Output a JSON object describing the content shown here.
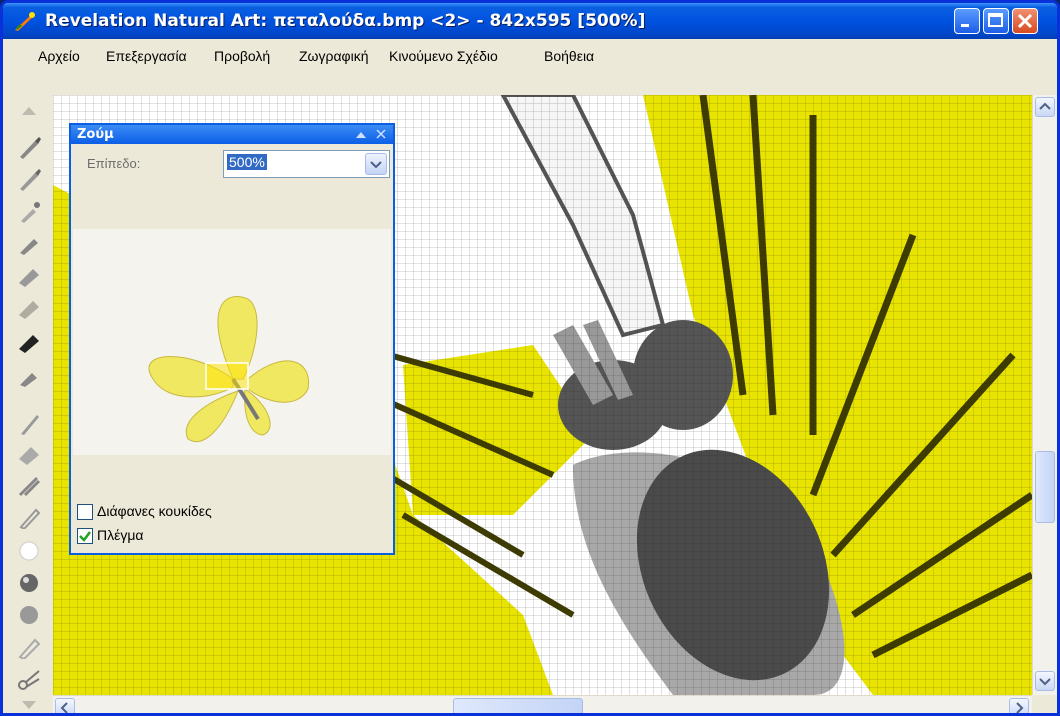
{
  "window": {
    "title": "Revelation Natural Art: πεταλούδα.bmp <2> - 842x595 [500%]",
    "colors": {
      "titlebar": "#0052e0",
      "canvas_yellow": "#e8e400",
      "grid": "#8a8600"
    }
  },
  "menu": [
    "Αρχείο",
    "Επεξεργασία",
    "Προβολή",
    "Ζωγραφική",
    "Κινούμενο Σχέδιο",
    "Βοήθεια"
  ],
  "zoom_panel": {
    "title": "Ζούμ",
    "level_label": "Επίπεδο:",
    "level_value": "500%",
    "transparent_dots_label": "Διάφανες κουκίδες",
    "transparent_dots_checked": false,
    "grid_label": "Πλέγμα",
    "grid_checked": true
  },
  "toolbar_icons": [
    "brush-icon",
    "brush-icon",
    "airbrush-icon",
    "pen-icon",
    "marker-icon",
    "pencil-icon",
    "chalk-icon",
    "crayon-icon",
    "knife-icon",
    "eraser-icon",
    "blender-icon",
    "pastel-icon",
    "circle-icon",
    "sphere-icon",
    "blob-icon",
    "smudge-icon",
    "scissors-icon"
  ]
}
